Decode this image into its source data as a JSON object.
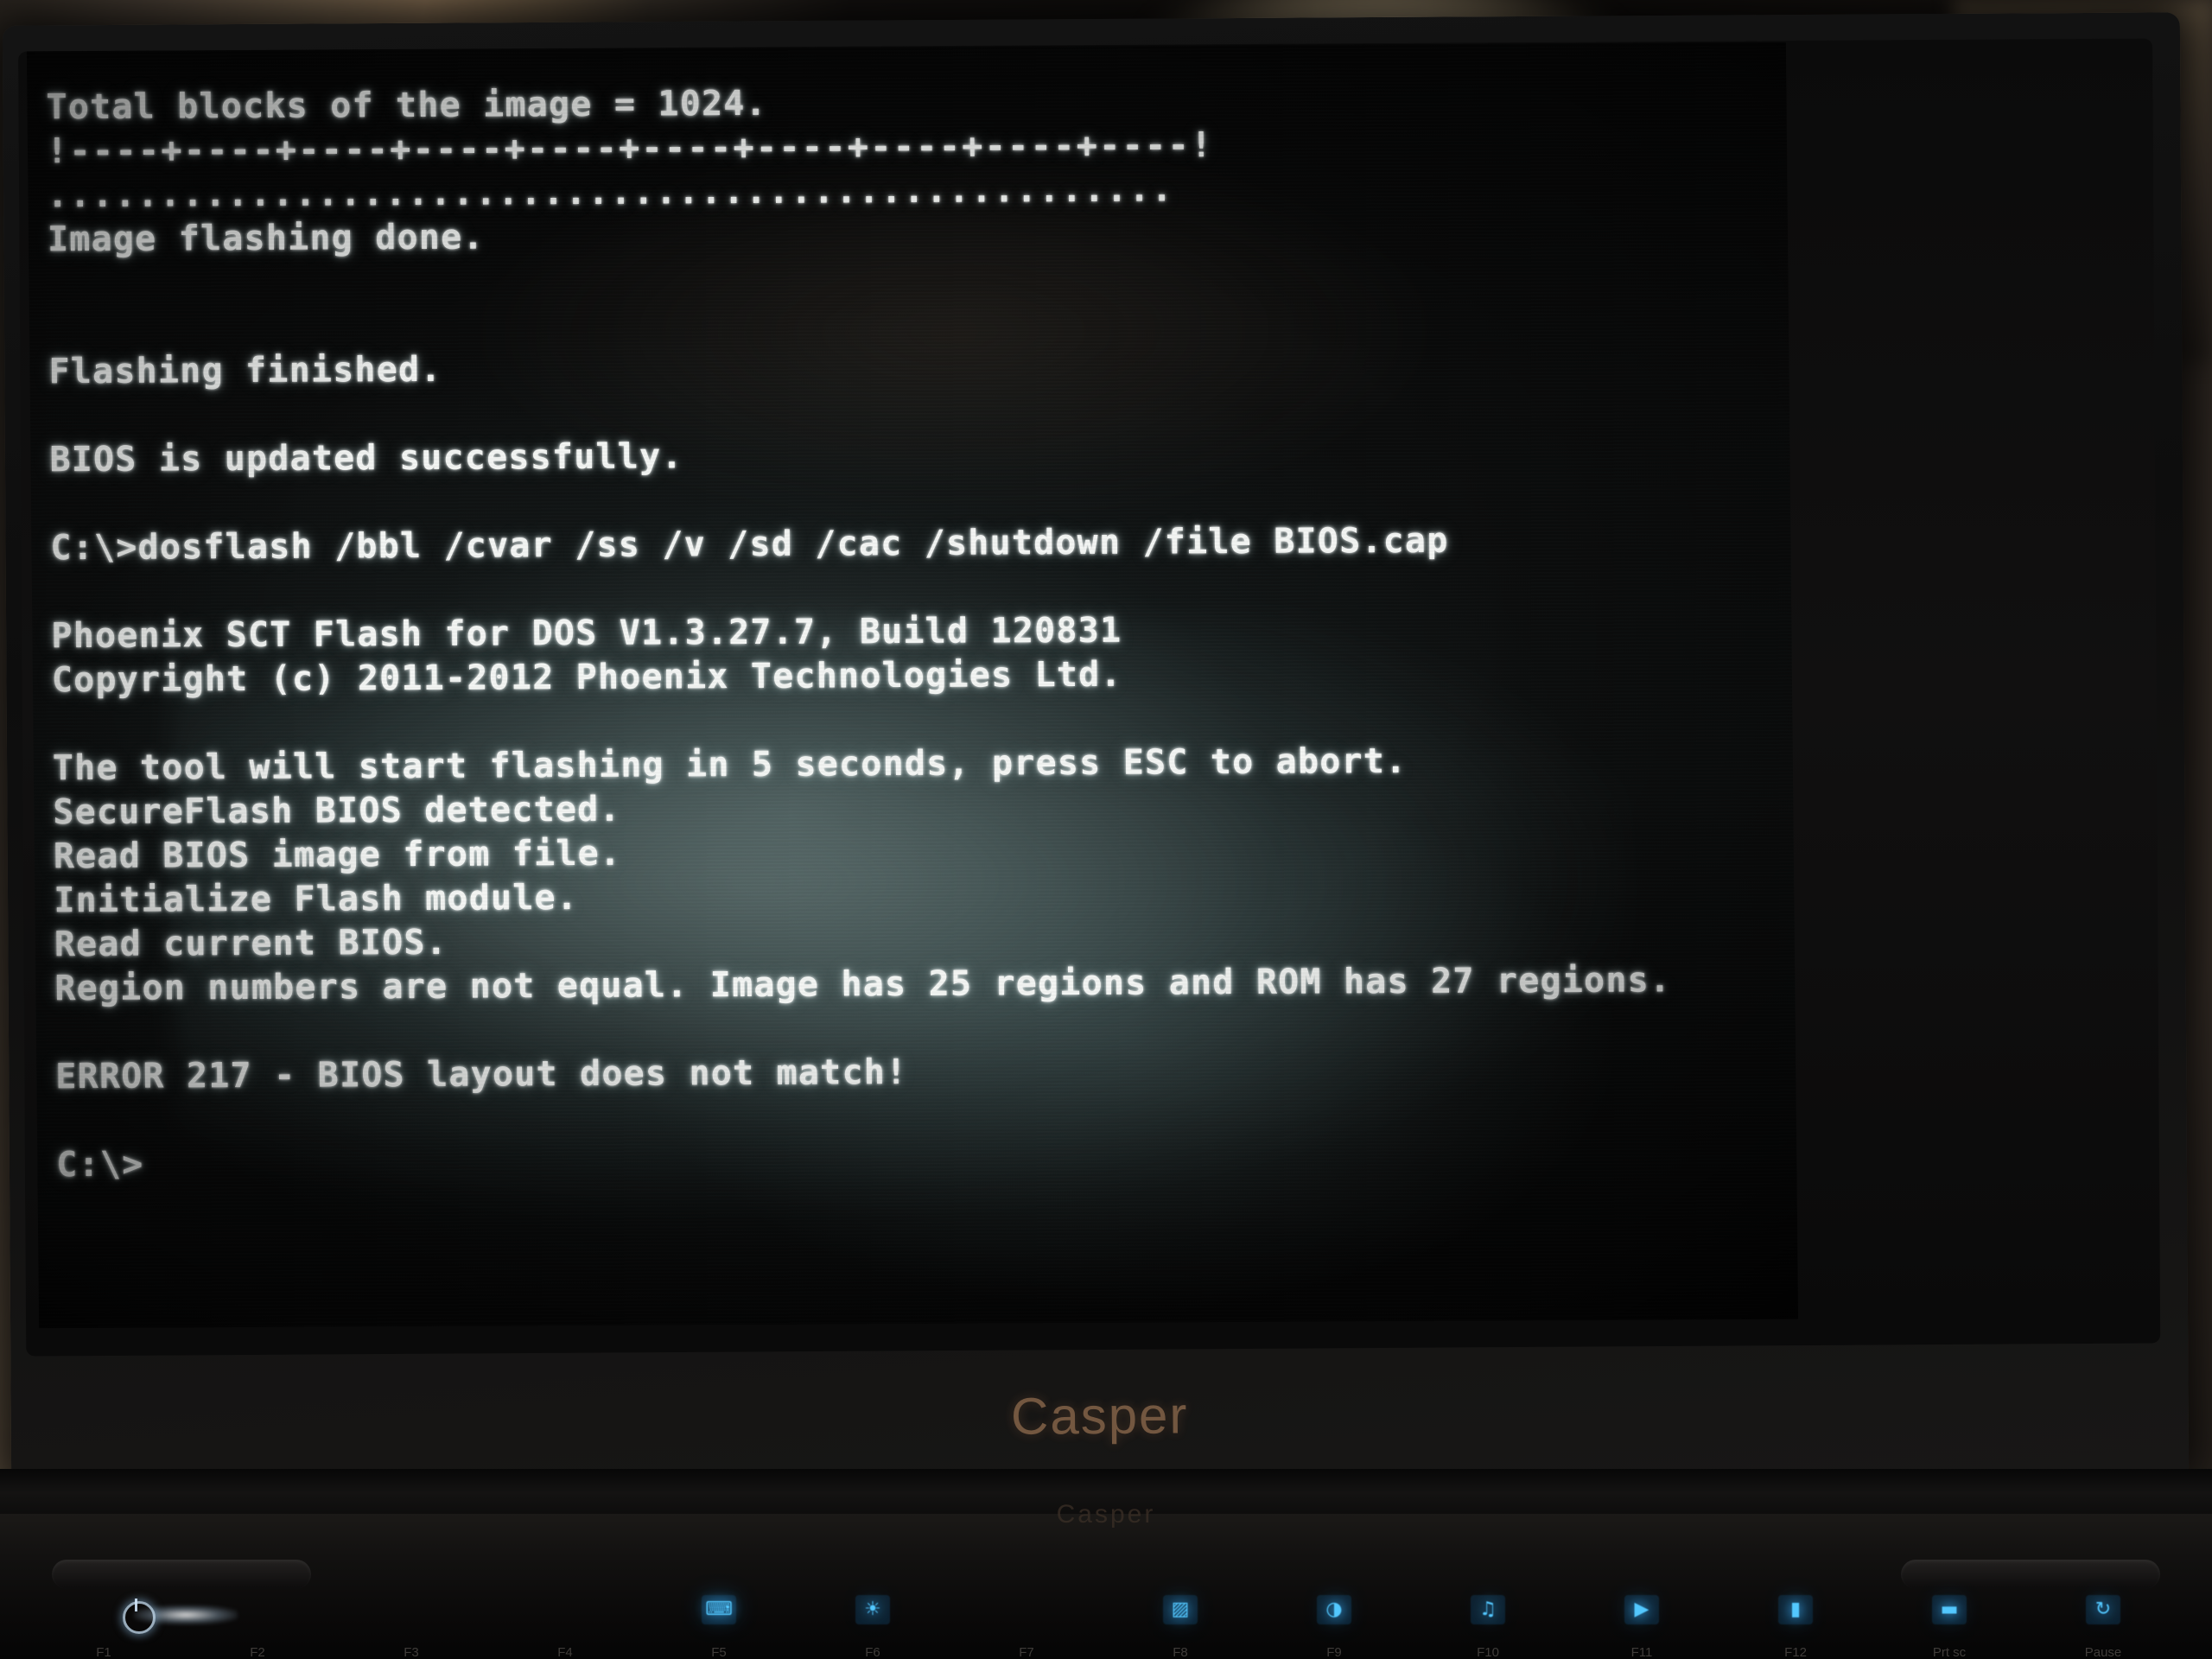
{
  "device": {
    "lid_brand": "Casper",
    "deck_brand": "Casper",
    "power_icon": "power-icon"
  },
  "keyboard": {
    "fkeys": [
      {
        "label": "F1",
        "icon": ""
      },
      {
        "label": "F2",
        "icon": ""
      },
      {
        "label": "F3",
        "icon": ""
      },
      {
        "label": "F4",
        "icon": ""
      },
      {
        "label": "F5",
        "icon": "⌨"
      },
      {
        "label": "F6",
        "icon": "☀"
      },
      {
        "label": "F7",
        "icon": ""
      },
      {
        "label": "F8",
        "icon": "▨"
      },
      {
        "label": "F9",
        "icon": "◑"
      },
      {
        "label": "F10",
        "icon": "♫"
      },
      {
        "label": "F11",
        "icon": "▶"
      },
      {
        "label": "F12",
        "icon": "▮"
      },
      {
        "label": "Prt sc",
        "icon": "▬"
      },
      {
        "label": "Pause",
        "icon": "↻"
      }
    ]
  },
  "console": {
    "lines": [
      {
        "id": "total-blocks",
        "text": "Total blocks of the image = 1024.",
        "style": ""
      },
      {
        "id": "progress-ruler",
        "text": "!----+----+----+----+----+----+----+----+----+----!",
        "style": "l-ruler"
      },
      {
        "id": "progress-dots",
        "text": "..................................................",
        "style": "l-dots"
      },
      {
        "id": "image-flash-done",
        "text": "Image flashing done.",
        "style": ""
      },
      {
        "id": "blank-1",
        "text": "",
        "style": "blank"
      },
      {
        "id": "blank-2",
        "text": "",
        "style": "blank"
      },
      {
        "id": "flashing-finished",
        "text": "Flashing finished.",
        "style": ""
      },
      {
        "id": "blank-3",
        "text": "",
        "style": "blank"
      },
      {
        "id": "bios-updated",
        "text": "BIOS is updated successfully.",
        "style": ""
      },
      {
        "id": "blank-4",
        "text": "",
        "style": "blank"
      },
      {
        "id": "command-prompt",
        "text": "C:\\>dosflash /bbl /cvar /ss /v /sd /cac /shutdown /file BIOS.cap",
        "style": ""
      },
      {
        "id": "blank-5",
        "text": "",
        "style": "blank"
      },
      {
        "id": "tool-banner",
        "text": "Phoenix SCT Flash for DOS V1.3.27.7, Build 120831",
        "style": ""
      },
      {
        "id": "copyright",
        "text": "Copyright (c) 2011-2012 Phoenix Technologies Ltd.",
        "style": ""
      },
      {
        "id": "blank-6",
        "text": "",
        "style": "blank"
      },
      {
        "id": "start-countdown",
        "text": "The tool will start flashing in 5 seconds, press ESC to abort.",
        "style": ""
      },
      {
        "id": "secureflash",
        "text": "SecureFlash BIOS detected.",
        "style": ""
      },
      {
        "id": "read-image",
        "text": "Read BIOS image from file.",
        "style": ""
      },
      {
        "id": "init-flash",
        "text": "Initialize Flash module.",
        "style": ""
      },
      {
        "id": "read-current",
        "text": "Read current BIOS.",
        "style": ""
      },
      {
        "id": "region-mismatch",
        "text": "Region numbers are not equal. Image has 25 regions and ROM has 27 regions.",
        "style": ""
      },
      {
        "id": "blank-7",
        "text": "",
        "style": "blank"
      },
      {
        "id": "error-line",
        "text": "ERROR 217 - BIOS layout does not match!",
        "style": ""
      },
      {
        "id": "blank-8",
        "text": "",
        "style": "blank"
      },
      {
        "id": "final-prompt",
        "text": "C:\\>",
        "style": ""
      }
    ],
    "total_blocks": 1024,
    "tool_version": "V1.3.27.7",
    "build": "120831",
    "image_regions": 25,
    "rom_regions": 27,
    "error_code": "ERROR 217",
    "error_message": "BIOS layout does not match!",
    "bios_file": "BIOS.cap",
    "text_color": "#f4f6f4",
    "background_color": "#070808"
  }
}
